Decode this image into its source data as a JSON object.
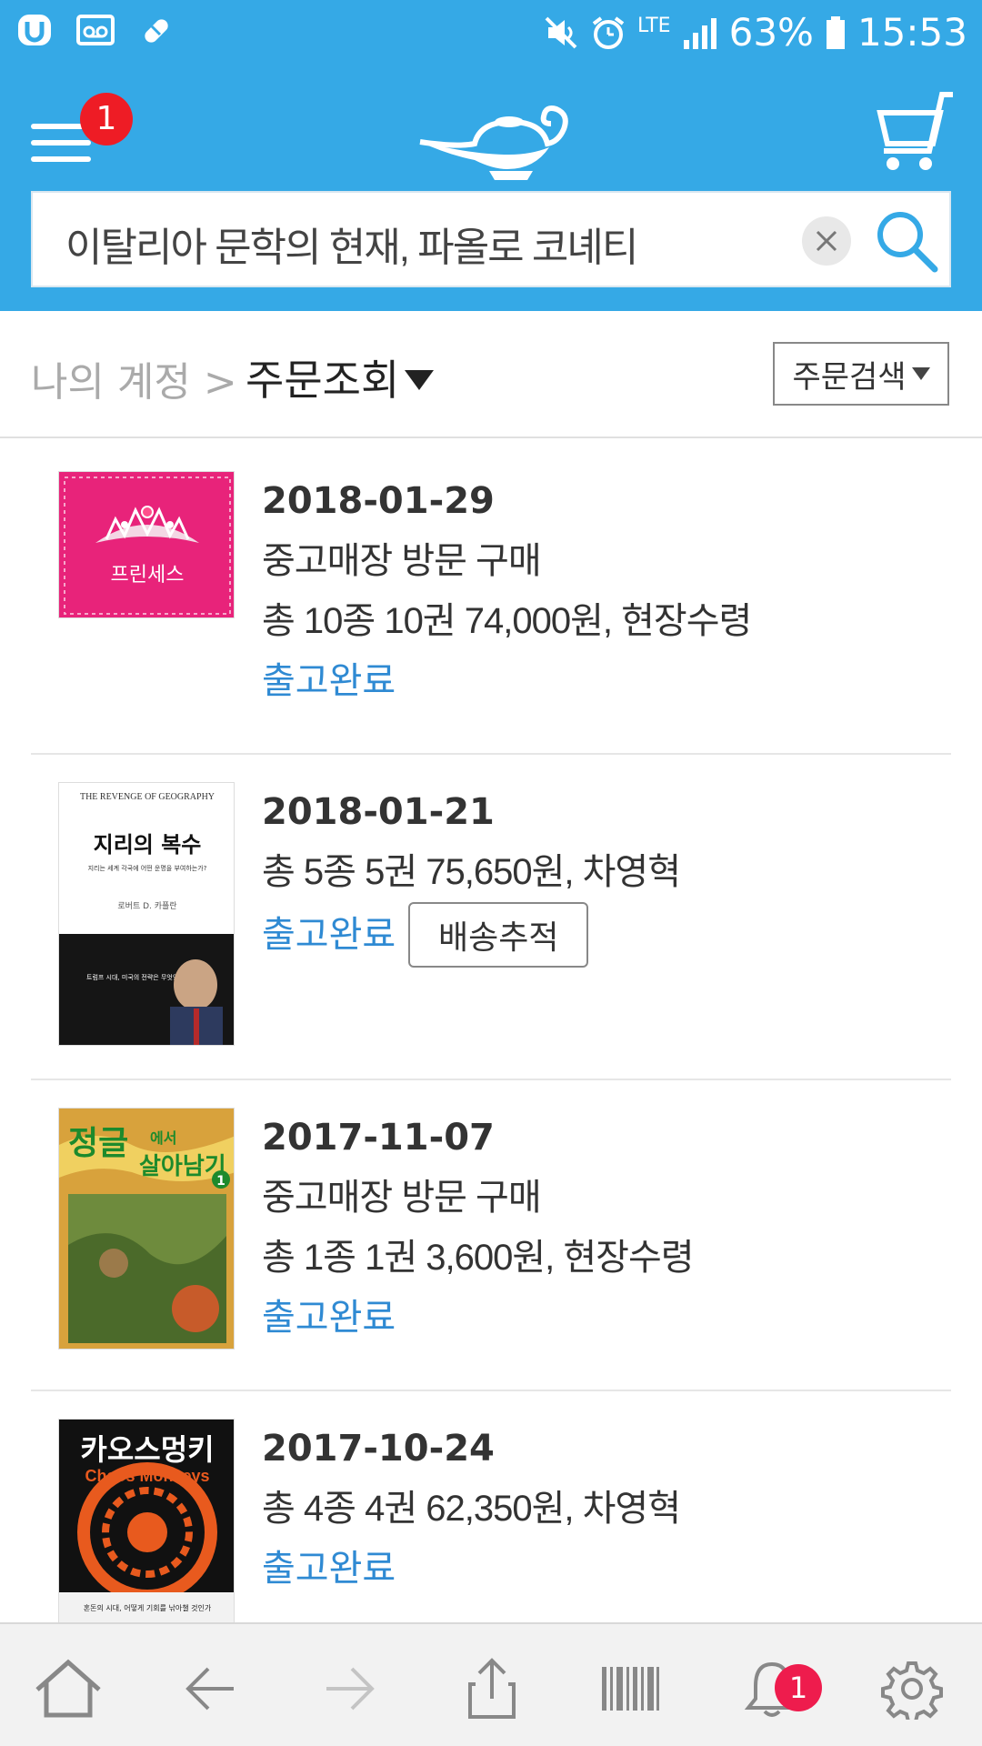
{
  "status_bar": {
    "battery": "63%",
    "time": "15:53",
    "network": "LTE"
  },
  "header": {
    "menu_badge": "1",
    "search_query": "이탈리아 문학의 현재, 파올로 코녜티"
  },
  "breadcrumb": {
    "parent": "나의 계정 >",
    "current": "주문조회",
    "order_search_label": "주문검색"
  },
  "orders": [
    {
      "date": "2018-01-29",
      "lines": [
        "중고매장 방문 구매",
        "총 10종 10권 74,000원, 현장수령"
      ],
      "status": "출고완료",
      "cover_title": "프린세스",
      "cover_color": "#e8237a"
    },
    {
      "date": "2018-01-21",
      "lines": [
        "총 5종 5권 75,650원, 차영혁"
      ],
      "status": "출고완료",
      "track_label": "배송추적",
      "cover_title": "지리의 복수",
      "cover_top": "THE REVENGE OF GEOGRAPHY",
      "cover_sub": "지리는 세계 각국에 어떤 운명을 부여하는가?",
      "cover_author": "로버트 D. 카플란",
      "cover_quote": "트럼프 시대, 미국의 전략은 무엇인가?"
    },
    {
      "date": "2017-11-07",
      "lines": [
        "중고매장 방문 구매",
        "총 1종 1권 3,600원, 현장수령"
      ],
      "status": "출고완료",
      "cover_title_a": "정글",
      "cover_title_b": "에서",
      "cover_title_c": "살아남기",
      "cover_num": "1"
    },
    {
      "date": "2017-10-24",
      "lines": [
        "총 4종 4권 62,350원, 차영혁"
      ],
      "status": "출고완료",
      "cover_title": "카오스멍키",
      "cover_en": "Chaos Monkeys",
      "cover_sub": "혼돈의 시대, 어떻게 기회를 낚아챌 것인가"
    }
  ],
  "bottom_nav": {
    "notification_badge": "1",
    "items": [
      "home-icon",
      "back-arrow-icon",
      "forward-arrow-icon",
      "share-icon",
      "barcode-icon",
      "bell-icon",
      "settings-icon"
    ]
  },
  "colors": {
    "brand": "#35a9e6",
    "status_blue": "#2f8ad3",
    "badge_red": "#ee1c25"
  }
}
